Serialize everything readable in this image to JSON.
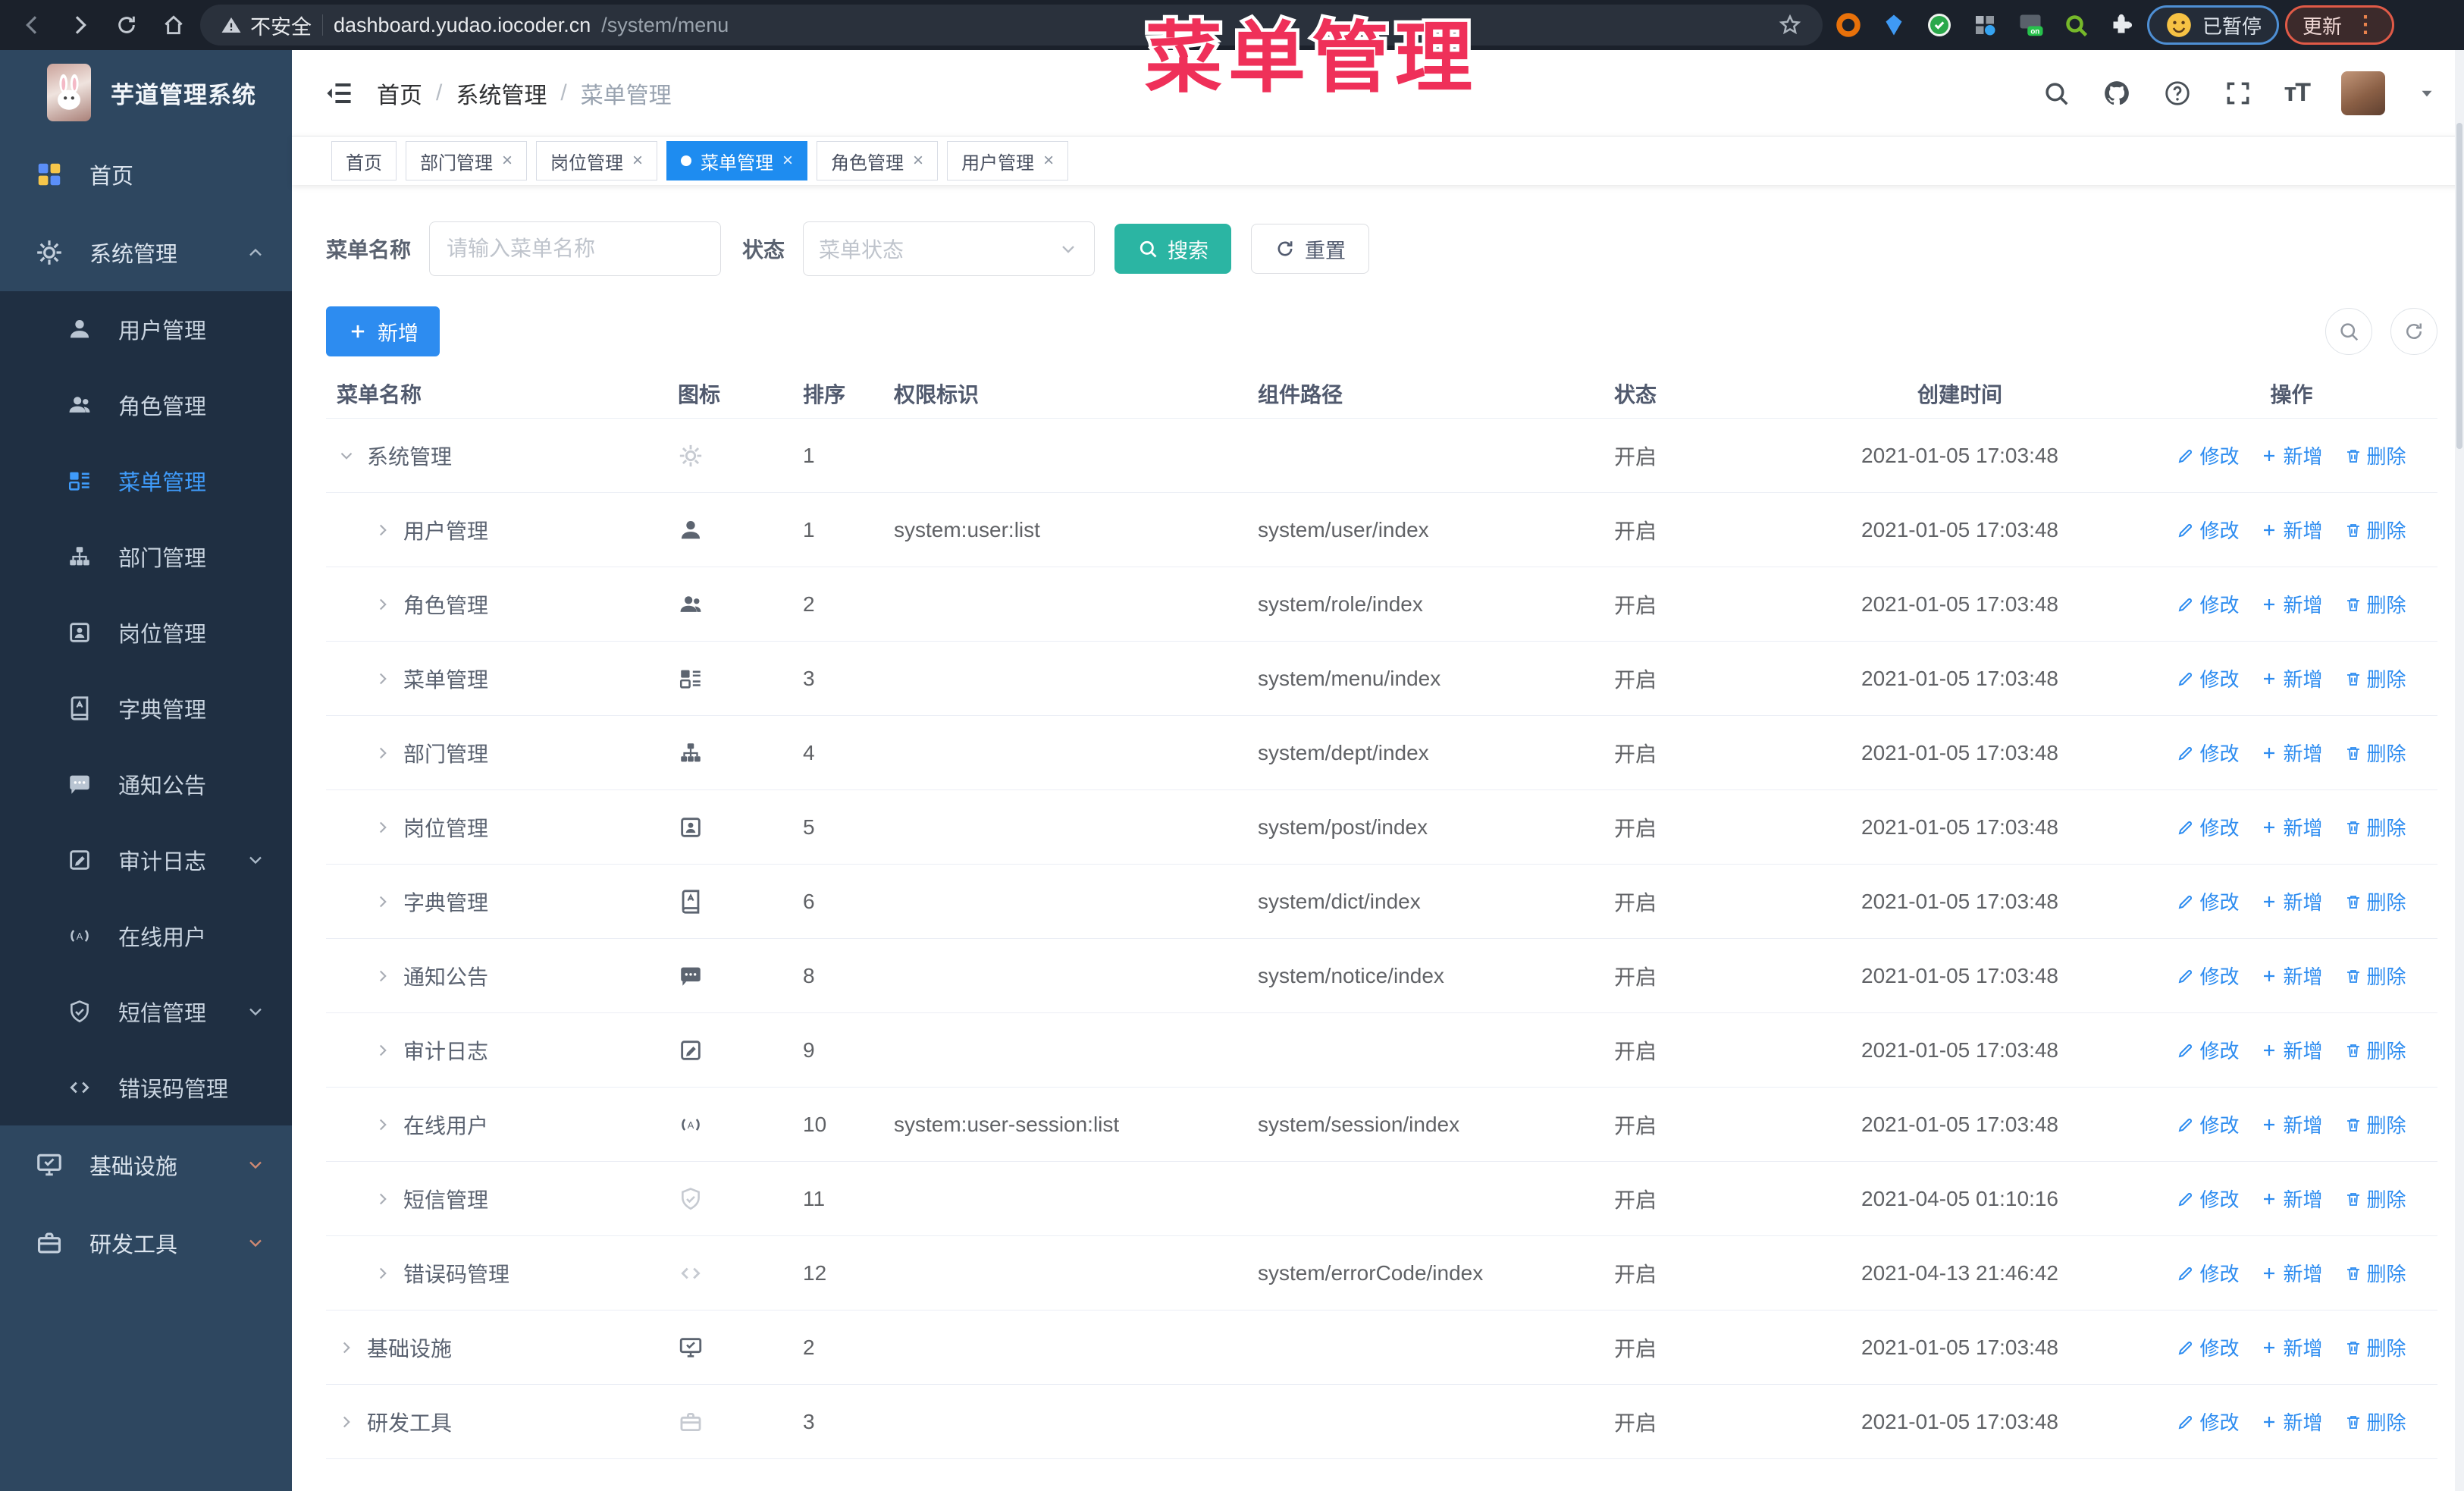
{
  "browser": {
    "security_label": "不安全",
    "url_host": "dashboard.yudao.iocoder.cn",
    "url_path": "/system/menu",
    "on_badge": "on",
    "paused_badge": "已暂停",
    "update_badge": "更新"
  },
  "annotation": {
    "title": "菜单管理",
    "color": "#ef3059"
  },
  "sidebar": {
    "logo_title": "芋道管理系统",
    "items": [
      {
        "key": "home",
        "label": "首页",
        "icon": "dashboard-icon",
        "level": 0
      },
      {
        "key": "system",
        "label": "系统管理",
        "icon": "gear-icon",
        "level": 0,
        "chevron": "up"
      },
      {
        "key": "user",
        "label": "用户管理",
        "icon": "user-icon",
        "level": 1
      },
      {
        "key": "role",
        "label": "角色管理",
        "icon": "users-icon",
        "level": 1
      },
      {
        "key": "menu",
        "label": "菜单管理",
        "icon": "menu-tree-icon",
        "level": 1,
        "active": true
      },
      {
        "key": "dept",
        "label": "部门管理",
        "icon": "org-icon",
        "level": 1
      },
      {
        "key": "post",
        "label": "岗位管理",
        "icon": "badge-icon",
        "level": 1
      },
      {
        "key": "dict",
        "label": "字典管理",
        "icon": "dict-icon",
        "level": 1
      },
      {
        "key": "notice",
        "label": "通知公告",
        "icon": "notice-icon",
        "level": 1
      },
      {
        "key": "audit-log",
        "label": "审计日志",
        "icon": "log-icon",
        "level": 1,
        "chevron": "down"
      },
      {
        "key": "online-user",
        "label": "在线用户",
        "icon": "online-icon",
        "level": 1
      },
      {
        "key": "sms",
        "label": "短信管理",
        "icon": "sms-icon",
        "level": 1,
        "chevron": "down"
      },
      {
        "key": "error-code",
        "label": "错误码管理",
        "icon": "code-icon",
        "level": 1
      },
      {
        "key": "infra",
        "label": "基础设施",
        "icon": "infra-icon",
        "level": 0,
        "chevron": "down",
        "warm": true
      },
      {
        "key": "dev-tools",
        "label": "研发工具",
        "icon": "tools-icon",
        "level": 0,
        "chevron": "down",
        "warm": true
      }
    ]
  },
  "header": {
    "breadcrumb": [
      "首页",
      "系统管理",
      "菜单管理"
    ]
  },
  "tags": [
    {
      "key": "home",
      "label": "首页",
      "closable": false,
      "active": false
    },
    {
      "key": "dept",
      "label": "部门管理",
      "closable": true,
      "active": false
    },
    {
      "key": "post",
      "label": "岗位管理",
      "closable": true,
      "active": false
    },
    {
      "key": "menu",
      "label": "菜单管理",
      "closable": true,
      "active": true
    },
    {
      "key": "role",
      "label": "角色管理",
      "closable": true,
      "active": false
    },
    {
      "key": "user",
      "label": "用户管理",
      "closable": true,
      "active": false
    }
  ],
  "filter": {
    "name_label": "菜单名称",
    "name_placeholder": "请输入菜单名称",
    "status_label": "状态",
    "status_placeholder": "菜单状态",
    "search_label": "搜索",
    "reset_label": "重置"
  },
  "toolbar": {
    "add_label": "新增"
  },
  "table": {
    "columns": [
      "菜单名称",
      "图标",
      "排序",
      "权限标识",
      "组件路径",
      "状态",
      "创建时间",
      "操作"
    ],
    "actions": [
      "修改",
      "新增",
      "删除"
    ],
    "rows": [
      {
        "name": "系统管理",
        "level": 0,
        "expanded": true,
        "icon": "gear-icon",
        "muted": true,
        "sort": "1",
        "perm": "",
        "path": "",
        "status": "开启",
        "time": "2021-01-05 17:03:48"
      },
      {
        "name": "用户管理",
        "level": 1,
        "icon": "user-icon",
        "sort": "1",
        "perm": "system:user:list",
        "path": "system/user/index",
        "status": "开启",
        "time": "2021-01-05 17:03:48"
      },
      {
        "name": "角色管理",
        "level": 1,
        "icon": "users-icon",
        "sort": "2",
        "perm": "",
        "path": "system/role/index",
        "status": "开启",
        "time": "2021-01-05 17:03:48"
      },
      {
        "name": "菜单管理",
        "level": 1,
        "icon": "menu-tree-icon",
        "sort": "3",
        "perm": "",
        "path": "system/menu/index",
        "status": "开启",
        "time": "2021-01-05 17:03:48"
      },
      {
        "name": "部门管理",
        "level": 1,
        "icon": "org-icon",
        "sort": "4",
        "perm": "",
        "path": "system/dept/index",
        "status": "开启",
        "time": "2021-01-05 17:03:48"
      },
      {
        "name": "岗位管理",
        "level": 1,
        "icon": "badge-icon",
        "sort": "5",
        "perm": "",
        "path": "system/post/index",
        "status": "开启",
        "time": "2021-01-05 17:03:48"
      },
      {
        "name": "字典管理",
        "level": 1,
        "icon": "dict-icon",
        "sort": "6",
        "perm": "",
        "path": "system/dict/index",
        "status": "开启",
        "time": "2021-01-05 17:03:48"
      },
      {
        "name": "通知公告",
        "level": 1,
        "icon": "notice-icon",
        "sort": "8",
        "perm": "",
        "path": "system/notice/index",
        "status": "开启",
        "time": "2021-01-05 17:03:48"
      },
      {
        "name": "审计日志",
        "level": 1,
        "icon": "log-icon",
        "sort": "9",
        "perm": "",
        "path": "",
        "status": "开启",
        "time": "2021-01-05 17:03:48"
      },
      {
        "name": "在线用户",
        "level": 1,
        "icon": "online-icon",
        "sort": "10",
        "perm": "system:user-session:list",
        "path": "system/session/index",
        "status": "开启",
        "time": "2021-01-05 17:03:48"
      },
      {
        "name": "短信管理",
        "level": 1,
        "icon": "sms-icon",
        "muted": true,
        "sort": "11",
        "perm": "",
        "path": "",
        "status": "开启",
        "time": "2021-04-05 01:10:16"
      },
      {
        "name": "错误码管理",
        "level": 1,
        "icon": "code-icon",
        "muted": true,
        "sort": "12",
        "perm": "",
        "path": "system/errorCode/index",
        "status": "开启",
        "time": "2021-04-13 21:46:42"
      },
      {
        "name": "基础设施",
        "level": 0,
        "icon": "infra-icon",
        "sort": "2",
        "perm": "",
        "path": "",
        "status": "开启",
        "time": "2021-01-05 17:03:48"
      },
      {
        "name": "研发工具",
        "level": 0,
        "icon": "tools-icon",
        "muted": true,
        "sort": "3",
        "perm": "",
        "path": "",
        "status": "开启",
        "time": "2021-01-05 17:03:48"
      }
    ]
  },
  "colors": {
    "accent": "#2d8cf0",
    "search_button": "#2bb5a3",
    "active_tag": "#1e8cf0",
    "sidebar_bg": "#2e4760",
    "submenu_bg": "#1f2f42"
  }
}
